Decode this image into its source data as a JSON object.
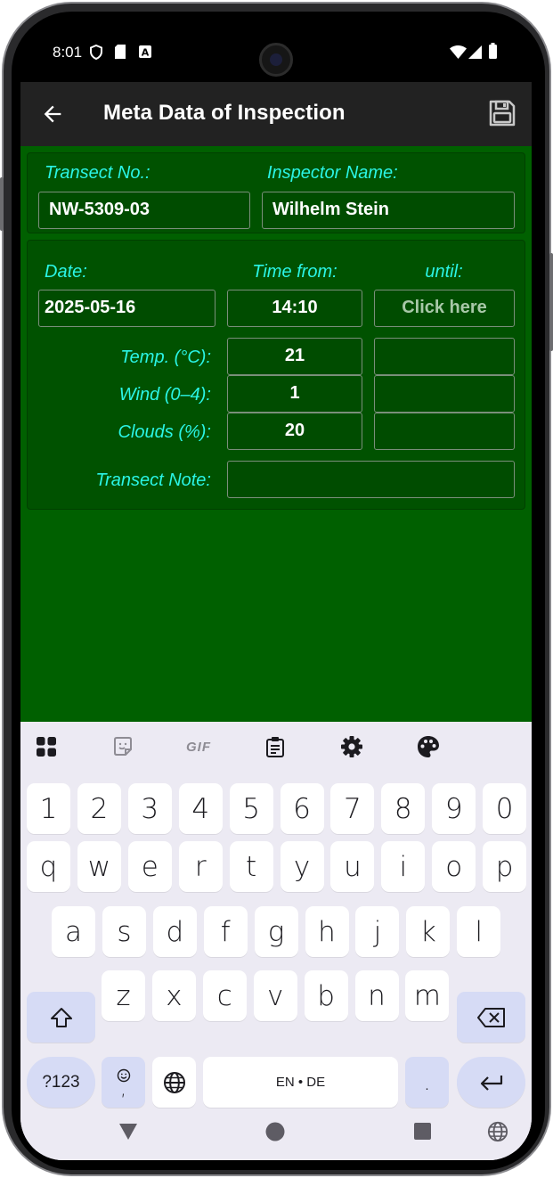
{
  "status_bar": {
    "time": "8:01"
  },
  "app_bar": {
    "title": "Meta Data of Inspection",
    "back_icon": "arrow-left-icon",
    "save_icon": "floppy-disk-icon"
  },
  "header_card": {
    "transect_label": "Transect No.:",
    "transect_value": "NW-5309-03",
    "inspector_label": "Inspector Name:",
    "inspector_value": "Wilhelm Stein"
  },
  "details_card": {
    "date_label": "Date:",
    "date_value": "2025-05-16",
    "time_from_label": "Time from:",
    "time_from_value": "14:10",
    "until_label": "until:",
    "until_placeholder": "Click here",
    "temp_label": "Temp. (°C):",
    "temp_from": "21",
    "temp_until": "",
    "wind_label": "Wind (0–4):",
    "wind_from": "1",
    "wind_until": "",
    "clouds_label": "Clouds (%):",
    "clouds_from": "20",
    "clouds_until": "",
    "note_label": "Transect Note:",
    "note_value": ""
  },
  "colors": {
    "content_bg": "#006000",
    "label": "#2af5e5",
    "appbar": "#222222",
    "keyboard_bg": "#eceaf3",
    "fn_key": "#d6dbf5"
  },
  "keyboard": {
    "toolbar": [
      "apps-grid-icon",
      "sticker-icon",
      "gif-icon",
      "clipboard-icon",
      "settings-gear-icon",
      "palette-icon"
    ],
    "gif_label": "GIF",
    "row_numbers": [
      "1",
      "2",
      "3",
      "4",
      "5",
      "6",
      "7",
      "8",
      "9",
      "0"
    ],
    "row_1": [
      "q",
      "w",
      "e",
      "r",
      "t",
      "y",
      "u",
      "i",
      "o",
      "p"
    ],
    "row_2": [
      "a",
      "s",
      "d",
      "f",
      "g",
      "h",
      "j",
      "k",
      "l"
    ],
    "row_3": [
      "z",
      "x",
      "c",
      "v",
      "b",
      "n",
      "m"
    ],
    "symbols_key": "?123",
    "comma_key": ",",
    "space_label": "EN • DE",
    "period_key": "."
  }
}
